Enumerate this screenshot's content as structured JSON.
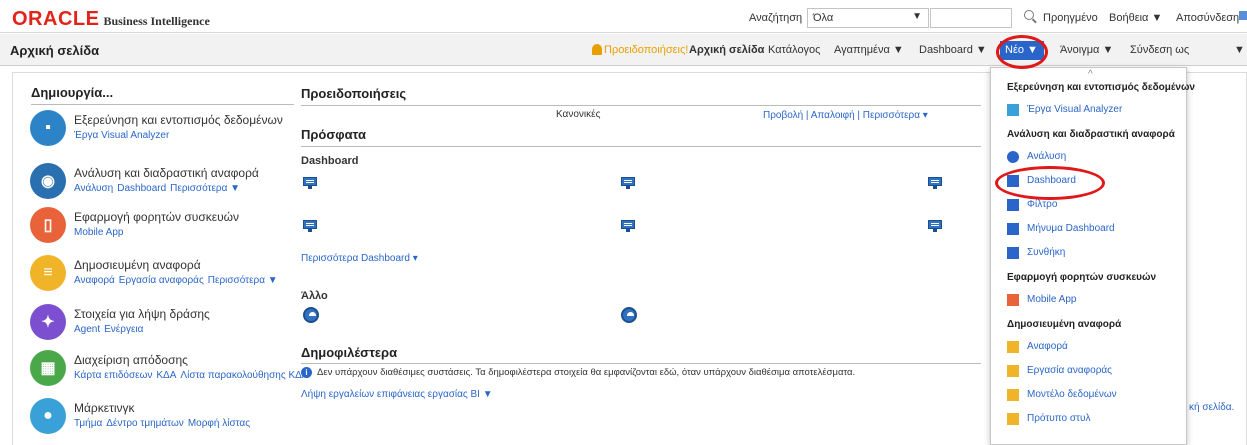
{
  "topbar": {
    "brand": "ORACLE",
    "product": "Business Intelligence",
    "search_label": "Αναζήτηση",
    "search_scope": "Όλα",
    "advanced": "Προηγμένο",
    "help": "Βοήθεια ▼",
    "logout": "Αποσύνδεση"
  },
  "header": {
    "title": "Αρχική σελίδα",
    "alerts": "Προειδοποιήσεις!",
    "home": "Αρχική σελίδα",
    "catalog": "Κατάλογος",
    "favorites": "Αγαπημένα ▼",
    "dashboards": "Dashboard ▼",
    "new": "Νέο ▼",
    "open": "Άνοιγμα ▼",
    "signed_in": "Σύνδεση ως",
    "more_caret": "▼"
  },
  "create": {
    "title": "Δημιουργία...",
    "items": [
      {
        "title": "Εξερεύνηση και εντοπισμός δεδομένων",
        "links": [
          "Έργα Visual Analyzer"
        ],
        "color": "#2d83c8"
      },
      {
        "title": "Ανάλυση και διαδραστική αναφορά",
        "links": [
          "Ανάλυση",
          "Dashboard",
          "Περισσότερα ▼"
        ],
        "color": "#2a6fb0"
      },
      {
        "title": "Εφαρμογή φορητών συσκευών",
        "links": [
          "Mobile App"
        ],
        "color": "#e8623a"
      },
      {
        "title": "Δημοσιευμένη αναφορά",
        "links": [
          "Αναφορά",
          "Εργασία αναφοράς",
          "Περισσότερα ▼"
        ],
        "color": "#f0b429"
      },
      {
        "title": "Στοιχεία για λήψη δράσης",
        "links": [
          "Agent",
          "Ενέργεια"
        ],
        "color": "#7b4fd0"
      },
      {
        "title": "Διαχείριση απόδοσης",
        "links": [
          "Κάρτα επιδόσεων",
          "ΚΔΑ",
          "Λίστα παρακολούθησης ΚΔΑ"
        ],
        "color": "#4aa84a"
      },
      {
        "title": "Μάρκετινγκ",
        "links": [
          "Τμήμα",
          "Δέντρο τμημάτων",
          "Μορφή λίστας"
        ],
        "color": "#3aa0d8"
      }
    ]
  },
  "alerts_section": {
    "title": "Προειδοποιήσεις",
    "normal": "Κανονικές",
    "actions": "Προβολή | Απαλοιφή | Περισσότερα ▾"
  },
  "recent": {
    "title": "Πρόσφατα",
    "dashboard_label": "Dashboard",
    "more_dashboards": "Περισσότερα Dashboard ▾",
    "other_label": "Άλλο"
  },
  "popular": {
    "title": "Δημοφιλέστερα",
    "info_glyph": "i",
    "message": "Δεν υπάρχουν διαθέσιμες συστάσεις. Τα δημοφιλέστερα στοιχεία θα εμφανίζονται εδώ, όταν υπάρχουν διαθέσιμα αποτελέσματα.",
    "download": "Λήψη εργαλείων επιφάνειας εργασίας BI ▼"
  },
  "menu": {
    "caret_up": "^",
    "sections": [
      {
        "header": "Εξερεύνηση και εντοπισμός δεδομένων",
        "items": [
          {
            "label": "Έργα Visual Analyzer",
            "icon": "visual-analyzer-icon"
          }
        ]
      },
      {
        "header": "Ανάλυση και διαδραστική αναφορά",
        "items": [
          {
            "label": "Ανάλυση",
            "icon": "analysis-icon"
          },
          {
            "label": "Dashboard",
            "icon": "dashboard-icon"
          },
          {
            "label": "Φίλτρο",
            "icon": "filter-icon"
          },
          {
            "label": "Μήνυμα Dashboard",
            "icon": "list-icon"
          },
          {
            "label": "Συνθήκη",
            "icon": "condition-icon"
          }
        ]
      },
      {
        "header": "Εφαρμογή φορητών συσκευών",
        "items": [
          {
            "label": "Mobile App",
            "icon": "mobile-app-icon"
          }
        ]
      },
      {
        "header": "Δημοσιευμένη αναφορά",
        "items": [
          {
            "label": "Αναφορά",
            "icon": "report-icon"
          },
          {
            "label": "Εργασία αναφοράς",
            "icon": "report-job-icon"
          },
          {
            "label": "Μοντέλο δεδομένων",
            "icon": "data-model-icon"
          },
          {
            "label": "Πρότυπο στυλ",
            "icon": "style-template-icon"
          }
        ]
      }
    ]
  },
  "overflow_text": "κή σελίδα."
}
